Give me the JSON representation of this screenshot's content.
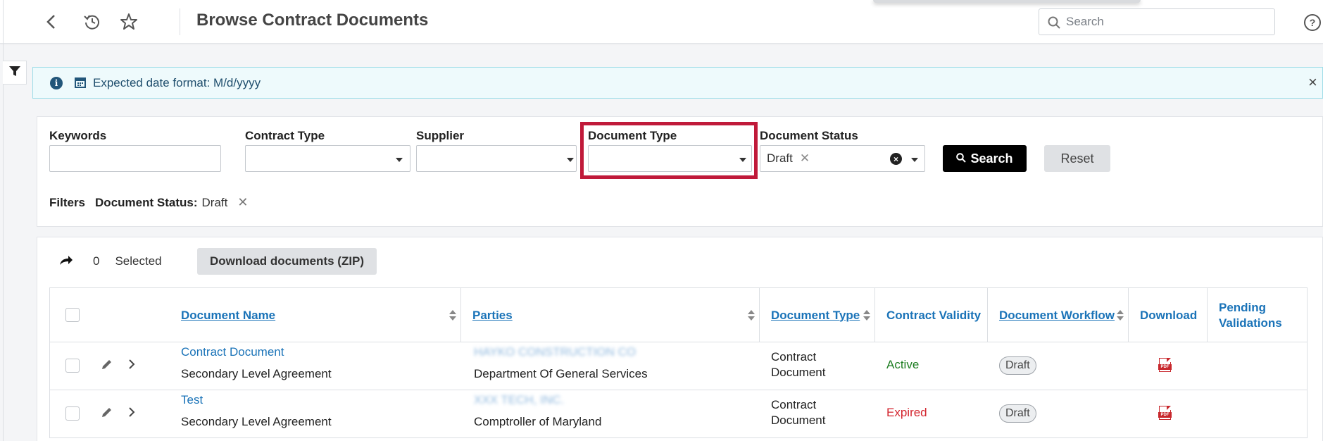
{
  "header": {
    "title": "Browse Contract Documents",
    "search_placeholder": "Search"
  },
  "banner": {
    "text": "Expected date format: M/d/yyyy"
  },
  "filters": {
    "keywords_label": "Keywords",
    "keywords_value": "",
    "contract_type_label": "Contract Type",
    "supplier_label": "Supplier",
    "document_type_label": "Document Type",
    "document_status_label": "Document Status",
    "document_status_chip": "Draft",
    "search_button": "Search",
    "reset_button": "Reset",
    "active_filters_label": "Filters",
    "active_filter_key": "Document Status:",
    "active_filter_value": "Draft"
  },
  "results": {
    "selected_count": "0",
    "selected_label": "Selected",
    "download_zip_label": "Download documents (ZIP)",
    "columns": [
      "Document Name",
      "Parties",
      "Document Type",
      "Contract Validity",
      "Document Workflow",
      "Download",
      "Pending Validations"
    ],
    "rows": [
      {
        "name": "Contract Document",
        "subtitle": "Secondary Level Agreement",
        "party_primary": "HAYKO CONSTRUCTION CO",
        "party_secondary": "Department Of General Services",
        "doc_type": "Contract Document",
        "validity": "Active",
        "validity_color": "#1e7e22",
        "workflow": "Draft"
      },
      {
        "name": "Test",
        "subtitle": "Secondary Level Agreement",
        "party_primary": "XXX TECH, INC.",
        "party_secondary": "Comptroller of Maryland",
        "doc_type": "Contract Document",
        "validity": "Expired",
        "validity_color": "#d3262f",
        "workflow": "Draft"
      }
    ]
  },
  "colors": {
    "accent_link": "#1a73b8",
    "highlight": "#c01a3a",
    "primary_button": "#000000"
  }
}
